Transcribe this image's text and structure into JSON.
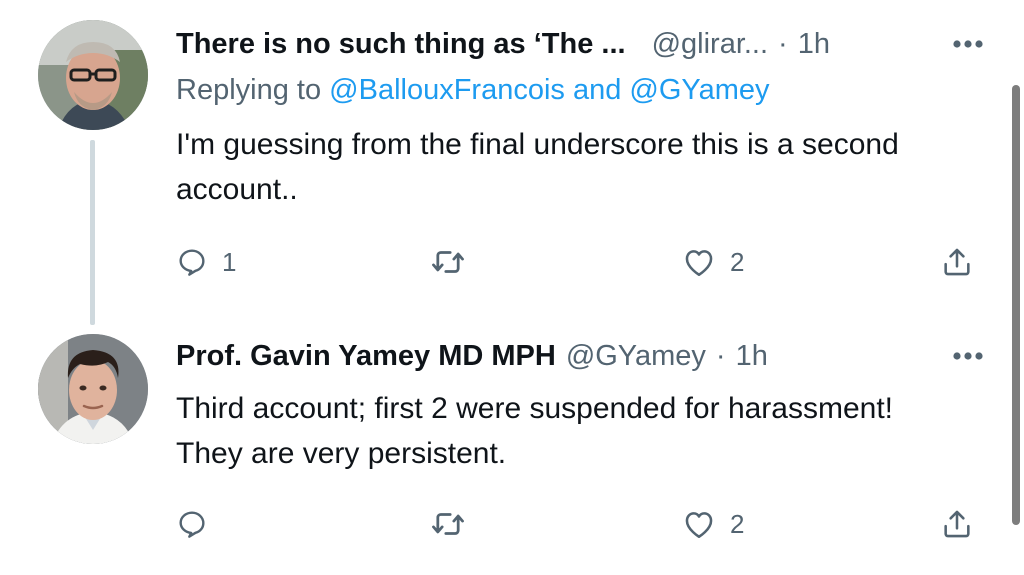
{
  "tweets": [
    {
      "name": "There is no such thing as ‘The ...",
      "handle": "@glirar...",
      "separator": "·",
      "time": "1h",
      "reply_prefix": "Replying to ",
      "reply_to_1": "@BallouxFrancois",
      "reply_and": " and ",
      "reply_to_2": "@GYamey",
      "text_line1": "I'm guessing from the final underscore this is a second",
      "text_line2": "account..",
      "reply_count": "1",
      "retweet_count": "",
      "like_count": "2"
    },
    {
      "name": "Prof. Gavin Yamey MD MPH",
      "handle": "@GYamey",
      "separator": "·",
      "time": "1h",
      "text_line1": "Third account; first 2 were suspended for harassment!",
      "text_line2": "They are very persistent.",
      "reply_count": "",
      "retweet_count": "",
      "like_count": "2"
    }
  ],
  "icons": {
    "more": "more-horizontal-icon",
    "reply": "reply-icon",
    "retweet": "retweet-icon",
    "like": "heart-icon",
    "share": "share-icon"
  },
  "colors": {
    "text": "#0f1419",
    "secondary": "#536471",
    "link": "#1d9bf0",
    "thread_line": "#cfd9de"
  }
}
